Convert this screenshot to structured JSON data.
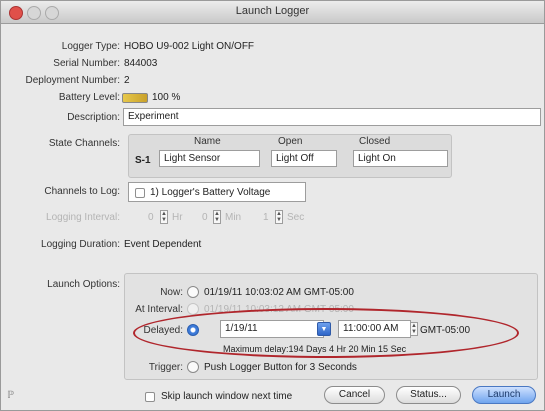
{
  "window": {
    "title": "Launch Logger"
  },
  "info": {
    "logger_type_label": "Logger Type:",
    "logger_type_value": "HOBO U9-002 Light ON/OFF",
    "serial_label": "Serial Number:",
    "serial_value": "844003",
    "deployment_label": "Deployment Number:",
    "deployment_value": "2",
    "battery_label": "Battery Level:",
    "battery_value": "100 %"
  },
  "description": {
    "label": "Description:",
    "value": "Experiment"
  },
  "state_channels": {
    "label": "State Channels:",
    "headers": {
      "name": "Name",
      "open": "Open",
      "closed": "Closed"
    },
    "row": {
      "id": "S-1",
      "name": "Light Sensor",
      "open": "Light Off",
      "closed": "Light On"
    }
  },
  "channels_to_log": {
    "label": "Channels to Log:",
    "item": "1) Logger's Battery Voltage"
  },
  "logging_interval": {
    "label": "Logging Interval:",
    "hr_value": "0",
    "hr_unit": "Hr",
    "min_value": "0",
    "min_unit": "Min",
    "sec_value": "1",
    "sec_unit": "Sec"
  },
  "logging_duration": {
    "label": "Logging Duration:",
    "value": "Event Dependent"
  },
  "launch_options": {
    "label": "Launch Options:",
    "now_label": "Now:",
    "now_value": "01/19/11 10:03:02 AM GMT-05:00",
    "interval_label": "At Interval:",
    "interval_value": "01/19/11 10:03:12 AM GMT-05:00",
    "delayed_label": "Delayed:",
    "delayed_date": "1/19/11",
    "delayed_time": "11:00:00 AM",
    "delayed_tz": "GMT-05:00",
    "max_delay": "Maximum delay:194 Days  4 Hr 20 Min 15 Sec",
    "trigger_label": "Trigger:",
    "trigger_value": "Push Logger Button for 3 Seconds"
  },
  "footer": {
    "skip_label": "Skip launch window next time",
    "cancel": "Cancel",
    "status": "Status...",
    "launch": "Launch"
  },
  "icons": {
    "battery": "battery-icon",
    "help": "help-icon"
  }
}
